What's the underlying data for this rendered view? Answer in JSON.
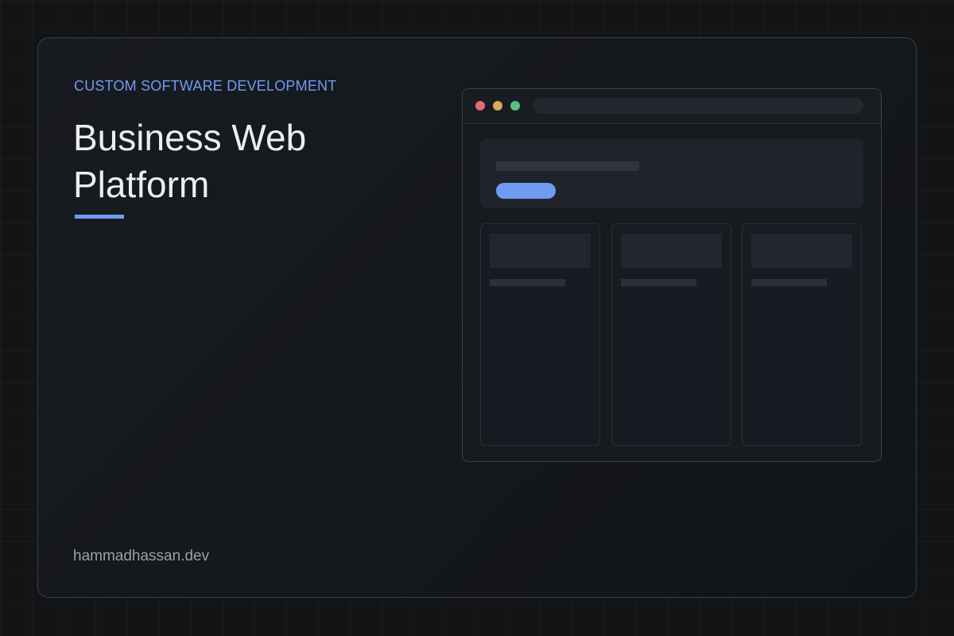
{
  "card": {
    "eyebrow": "CUSTOM SOFTWARE DEVELOPMENT",
    "title": "Business Web Platform",
    "footer_domain": "hammadhassan.dev"
  },
  "browser_mockup": {
    "window_controls": [
      "close-dot",
      "minimize-dot",
      "maximize-dot"
    ],
    "feature_card_count": 3
  },
  "colors": {
    "accent": "#6f9cf0",
    "background": "#131416",
    "card_border": "#3a3f48",
    "title_text": "#eceef2",
    "footer_text": "#9aa0aa",
    "dot_red": "#e06c75",
    "dot_yellow": "#d9a85b",
    "dot_green": "#5fbd84"
  }
}
